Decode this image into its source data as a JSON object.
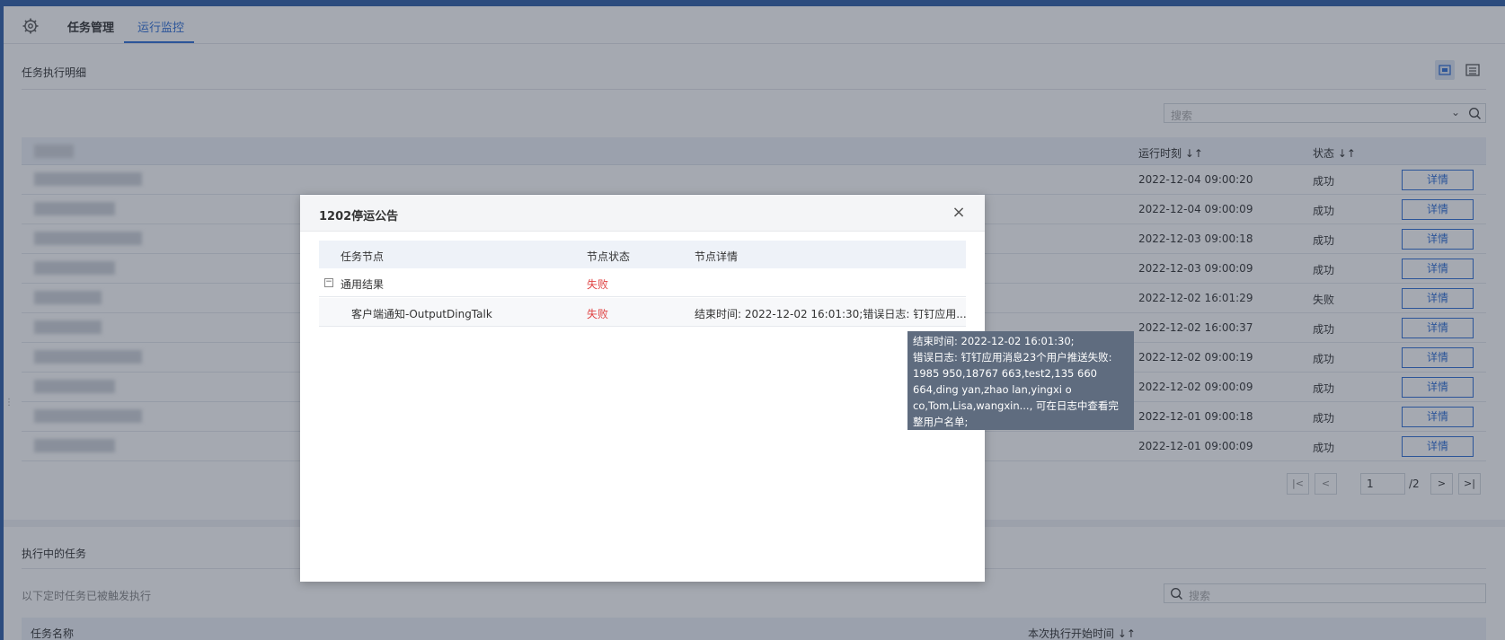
{
  "tabs": {
    "settings_icon": "gear-icon",
    "task_manage": "任务管理",
    "run_monitor": "运行监控"
  },
  "exec_detail": {
    "title": "任务执行明细",
    "search_placeholder": "搜索",
    "columns": {
      "run_time": "运行时刻 ↓↑",
      "status": "状态 ↓↑"
    },
    "rows": [
      {
        "time": "2022-12-04 09:00:20",
        "status": "成功",
        "action": "详情"
      },
      {
        "time": "2022-12-04 09:00:09",
        "status": "成功",
        "action": "详情"
      },
      {
        "time": "2022-12-03 09:00:18",
        "status": "成功",
        "action": "详情"
      },
      {
        "time": "2022-12-03 09:00:09",
        "status": "成功",
        "action": "详情"
      },
      {
        "time": "2022-12-02 16:01:29",
        "status": "失败",
        "action": "详情"
      },
      {
        "time": "2022-12-02 16:00:37",
        "status": "成功",
        "action": "详情"
      },
      {
        "time": "2022-12-02 09:00:19",
        "status": "成功",
        "action": "详情"
      },
      {
        "time": "2022-12-02 09:00:09",
        "status": "成功",
        "action": "详情"
      },
      {
        "time": "2022-12-01 09:00:18",
        "status": "成功",
        "action": "详情"
      },
      {
        "time": "2022-12-01 09:00:09",
        "status": "成功",
        "action": "详情"
      }
    ],
    "pager": {
      "current": "1",
      "total": "/2"
    }
  },
  "running": {
    "title": "执行中的任务",
    "subtitle": "以下定时任务已被触发执行",
    "search_placeholder": "搜索",
    "columns": {
      "name": "任务名称",
      "start_time": "本次执行开始时间 ↓↑"
    }
  },
  "modal": {
    "title": "1202停运公告",
    "close": "×",
    "columns": {
      "node": "任务节点",
      "node_status": "节点状态",
      "node_detail": "节点详情"
    },
    "rows": [
      {
        "node": "通用结果",
        "status": "失败",
        "detail": ""
      },
      {
        "node": "客户端通知-OutputDingTalk",
        "status": "失败",
        "detail": "结束时间: 2022-12-02 16:01:30;错误日志: 钉钉应用..."
      }
    ]
  },
  "tooltip": {
    "lines": [
      "结束时间: 2022-12-02 16:01:30;",
      "错误日志: 钉钉应用消息23个用户推送失败:",
      "1985      950,18767      663,test2,135      660",
      "664,ding      yan,zhao      lan,yingxi        o",
      "co,Tom,Lisa,wangxin...,  可在日志中查看完",
      "整用户名单;"
    ]
  },
  "colors": {
    "primary": "#2f6fd6",
    "fail": "#e04545",
    "topbar": "#2f5fa8"
  }
}
